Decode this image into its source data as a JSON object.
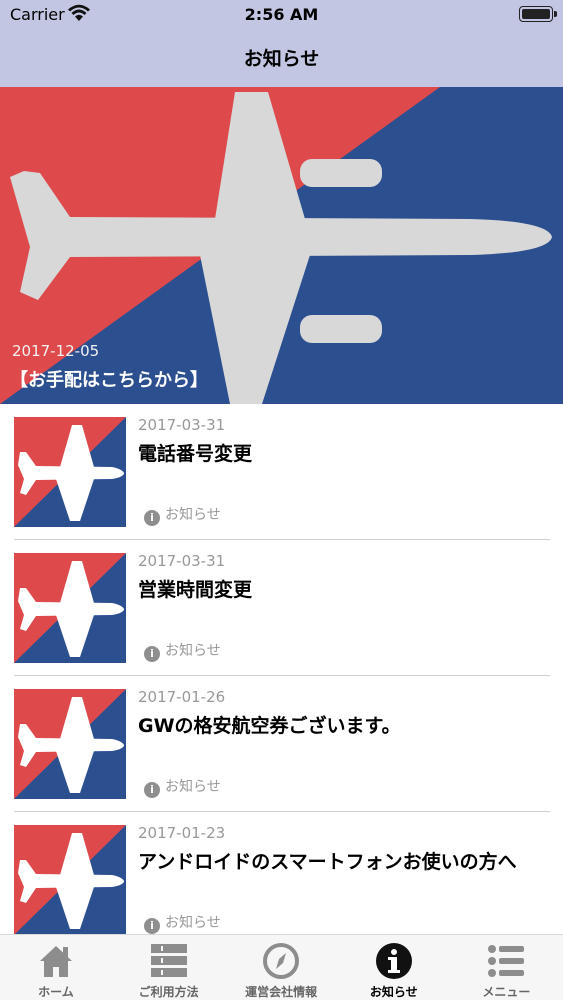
{
  "status_bar": {
    "carrier": "Carrier",
    "time": "2:56 AM"
  },
  "nav": {
    "title": "お知らせ"
  },
  "colors": {
    "nav_bg": "#c3c6e2",
    "brand_red": "#de4a4c",
    "brand_blue": "#2c4f8f",
    "tab_active": "#000000",
    "tab_inactive": "#666666"
  },
  "hero": {
    "date": "2017-12-05",
    "title": "【お手配はこちらから】",
    "image": "airplane-banner"
  },
  "news": [
    {
      "date": "2017-03-31",
      "title": "電話番号変更",
      "category": "お知らせ",
      "category_icon": "info-icon"
    },
    {
      "date": "2017-03-31",
      "title": "営業時間変更",
      "category": "お知らせ",
      "category_icon": "info-icon"
    },
    {
      "date": "2017-01-26",
      "title": "GWの格安航空券ございます。",
      "category": "お知らせ",
      "category_icon": "info-icon"
    },
    {
      "date": "2017-01-23",
      "title": "アンドロイドのスマートフォンお使いの方へ",
      "category": "お知らせ",
      "category_icon": "info-icon"
    }
  ],
  "tabs": [
    {
      "label": "ホーム",
      "icon": "home-icon",
      "active": false
    },
    {
      "label": "ご利用方法",
      "icon": "list-layout-icon",
      "active": false
    },
    {
      "label": "運営会社情報",
      "icon": "compass-icon",
      "active": false
    },
    {
      "label": "お知らせ",
      "icon": "info-icon",
      "active": true
    },
    {
      "label": "メニュー",
      "icon": "menu-icon",
      "active": false
    }
  ]
}
